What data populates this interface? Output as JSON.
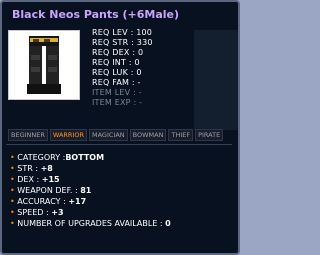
{
  "tooltip": {
    "title": "Black Neos Pants (+6Male)",
    "requirements": [
      {
        "label": "REQ LEV",
        "value": ": 100",
        "dim": false
      },
      {
        "label": "REQ STR",
        "value": ": 330",
        "dim": false
      },
      {
        "label": "REQ DEX",
        "value": ": 0",
        "dim": false
      },
      {
        "label": "REQ INT",
        "value": ": 0",
        "dim": false
      },
      {
        "label": "REQ LUK",
        "value": ": 0",
        "dim": false
      },
      {
        "label": "REQ FAM",
        "value": ": -",
        "dim": false
      },
      {
        "label": "ITEM LEV",
        "value": ": -",
        "dim": true
      },
      {
        "label": "ITEM EXP",
        "value": ": -",
        "dim": true
      }
    ],
    "jobs": [
      {
        "label": "BEGINNER",
        "active": false
      },
      {
        "label": "WARRIOR",
        "active": true
      },
      {
        "label": "MAGICIAN",
        "active": false
      },
      {
        "label": "BOWMAN",
        "active": false
      },
      {
        "label": "THIEF",
        "active": false
      },
      {
        "label": "PIRATE",
        "active": false
      }
    ],
    "details": [
      {
        "label": "CATEGORY :",
        "value": "BOTTOM"
      },
      {
        "label": "STR :",
        "value": "+8"
      },
      {
        "label": "DEX :",
        "value": "+15"
      },
      {
        "label": "WEAPON DEF. :",
        "value": "81"
      },
      {
        "label": "ACCURACY :",
        "value": "+17"
      },
      {
        "label": "SPEED :",
        "value": "+3"
      },
      {
        "label": "NUMBER OF UPGRADES AVAILABLE :",
        "value": "0"
      }
    ]
  }
}
